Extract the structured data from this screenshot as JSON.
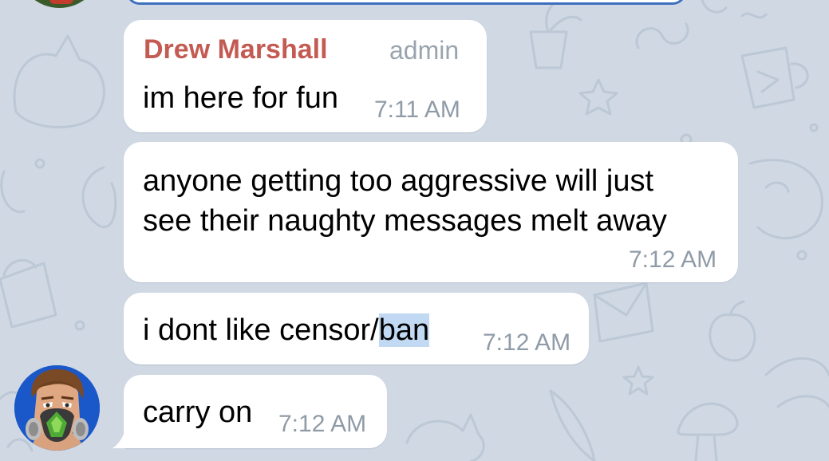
{
  "chat": {
    "messages": [
      {
        "sender": "Drew Marshall",
        "role": "admin",
        "text": "im here for fun",
        "time": "7:11 AM"
      },
      {
        "line1": "anyone getting too aggressive will just",
        "line2": "see their naughty messages melt away",
        "time": "7:12 AM"
      },
      {
        "text_before": "i dont like censor/",
        "text_selected": "ban",
        "time": "7:12 AM"
      },
      {
        "text": "carry on",
        "time": "7:12 AM"
      }
    ]
  },
  "colors": {
    "background": "#cfd8e3",
    "sender_name": "#c45b53",
    "timestamp": "#8f9ba7",
    "selection": "#c1d9f2",
    "avatar_bg": "#1a57c8"
  },
  "icons": {
    "avatar": "gas-mask-avatar"
  }
}
